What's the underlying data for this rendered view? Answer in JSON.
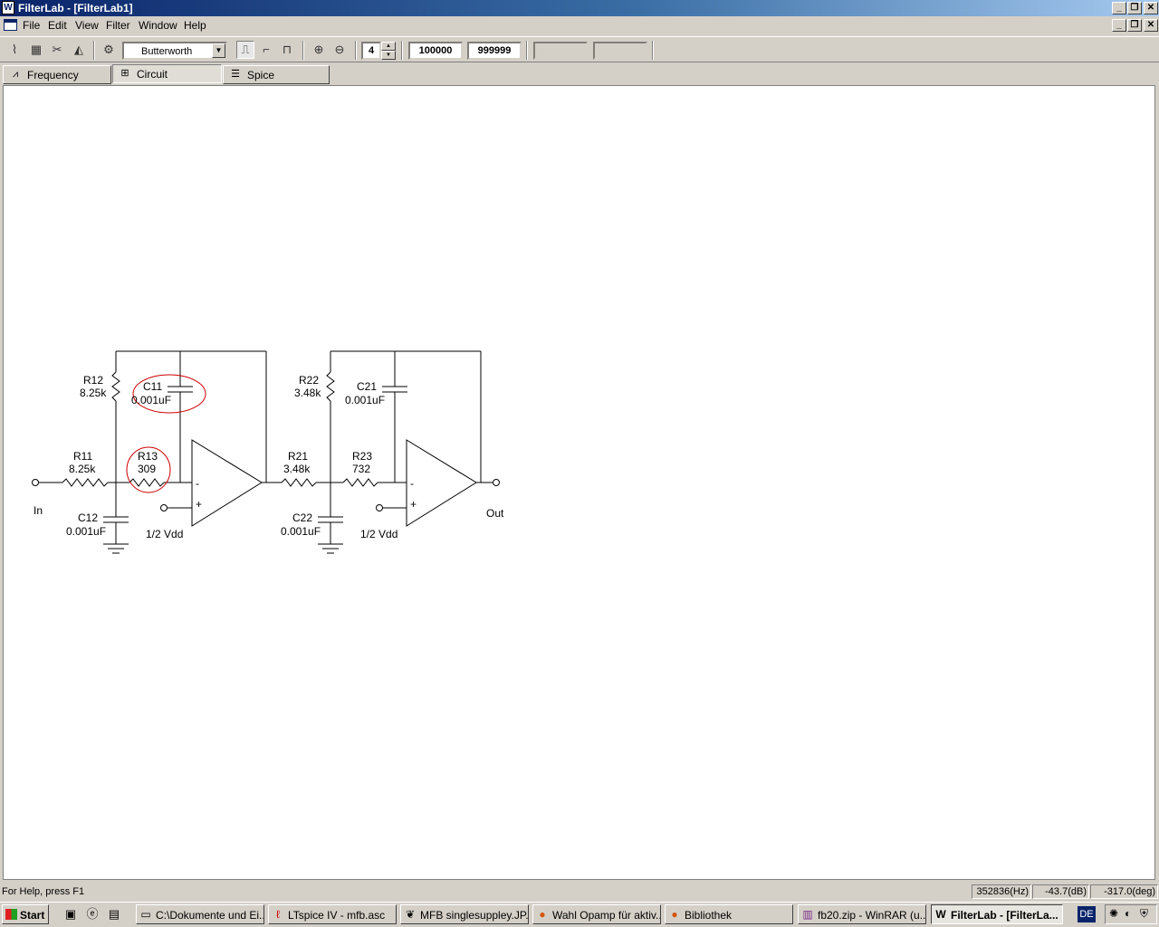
{
  "window": {
    "title": "FilterLab - [FilterLab1]",
    "min_glyph": "_",
    "restore_glyph": "❐",
    "close_glyph": "✕"
  },
  "menu": {
    "file": "File",
    "edit": "Edit",
    "view": "View",
    "filter": "Filter",
    "window": "Window",
    "help": "Help"
  },
  "toolbar": {
    "filter_type": "Butterworth",
    "order": "4",
    "frequency_1": "100000",
    "frequency_2": "999999"
  },
  "tabs": {
    "frequency": "Frequency",
    "circuit": "Circuit",
    "spice": "Spice"
  },
  "circuit": {
    "stage1": {
      "r11_name": "R11",
      "r11_value": "8.25k",
      "r12_name": "R12",
      "r12_value": "8.25k",
      "r13_name": "R13",
      "r13_value": "309",
      "c11_name": "C11",
      "c11_value": "0.001uF",
      "c12_name": "C12",
      "c12_value": "0.001uF",
      "ref_label": "1/2 Vdd"
    },
    "stage2": {
      "r21_name": "R21",
      "r21_value": "3.48k",
      "r22_name": "R22",
      "r22_value": "3.48k",
      "r23_name": "R23",
      "r23_value": "732",
      "c21_name": "C21",
      "c21_value": "0.001uF",
      "c22_name": "C22",
      "c22_value": "0.001uF",
      "ref_label": "1/2 Vdd"
    },
    "input_label": "In",
    "output_label": "Out",
    "minus_sign": "-",
    "plus_sign": "+",
    "highlight_color": "#cc0000"
  },
  "status": {
    "help": "For Help, press F1",
    "frequency": "352836(Hz)",
    "gain": "-43.7(dB)",
    "phase": "-317.0(deg)"
  },
  "taskbar": {
    "start": "Start",
    "tasks": [
      "C:\\Dokumente und Ei...",
      "LTspice IV - mfb.asc",
      "MFB singlesuppley.JP...",
      "Wahl Opamp für aktiv...",
      "Bibliothek",
      "fb20.zip - WinRAR (u...",
      "FilterLab - [FilterLa..."
    ],
    "language": "DE"
  }
}
